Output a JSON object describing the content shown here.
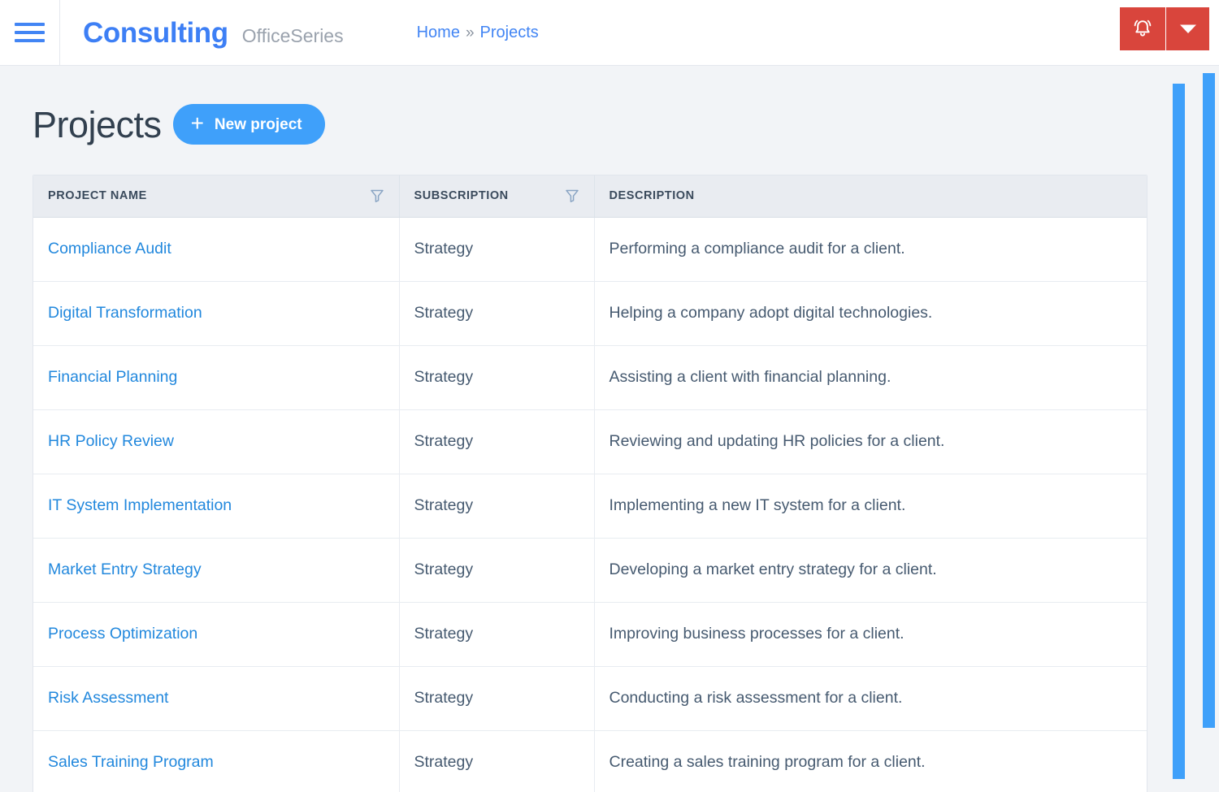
{
  "topbar": {
    "menu_icon": "hamburger-icon",
    "brand_main": "Consulting",
    "brand_sub": "OfficeSeries",
    "breadcrumb": {
      "home": "Home",
      "separator": "»",
      "current": "Projects"
    },
    "actions": {
      "alert_icon": "bell-icon",
      "caret_icon": "chevron-down-icon",
      "button_color": "#d9453c"
    }
  },
  "page": {
    "title": "Projects",
    "new_button": {
      "label": "New project",
      "plus": "+",
      "color": "#3fa0fa"
    }
  },
  "table": {
    "columns": [
      {
        "label": "PROJECT NAME",
        "filter_icon": "filter-funnel-icon",
        "has_filter": true
      },
      {
        "label": "SUBSCRIPTION",
        "filter_icon": "filter-funnel-icon",
        "has_filter": true
      },
      {
        "label": "DESCRIPTION",
        "filter_icon": "",
        "has_filter": false
      }
    ],
    "rows": [
      {
        "name": "Compliance Audit",
        "subscription": "Strategy",
        "description": "Performing a compliance audit for a client."
      },
      {
        "name": "Digital Transformation",
        "subscription": "Strategy",
        "description": "Helping a company adopt digital technologies."
      },
      {
        "name": "Financial Planning",
        "subscription": "Strategy",
        "description": "Assisting a client with financial planning."
      },
      {
        "name": "HR Policy Review",
        "subscription": "Strategy",
        "description": "Reviewing and updating HR policies for a client."
      },
      {
        "name": "IT System Implementation",
        "subscription": "Strategy",
        "description": "Implementing a new IT system for a client."
      },
      {
        "name": "Market Entry Strategy",
        "subscription": "Strategy",
        "description": "Developing a market entry strategy for a client."
      },
      {
        "name": "Process Optimization",
        "subscription": "Strategy",
        "description": "Improving business processes for a client."
      },
      {
        "name": "Risk Assessment",
        "subscription": "Strategy",
        "description": "Conducting a risk assessment for a client."
      },
      {
        "name": "Sales Training Program",
        "subscription": "Strategy",
        "description": "Creating a sales training program for a client."
      }
    ]
  },
  "scrollbars": {
    "inner_color": "#3fa0fa",
    "outer_color": "#3fa0fa"
  },
  "colors": {
    "brand_blue": "#3d7ff5",
    "link_blue": "#2288dd",
    "accent_blue": "#3fa0fa",
    "alert_red": "#d9453c",
    "page_bg": "#f2f4f7",
    "header_bg": "#e9ecf1"
  }
}
